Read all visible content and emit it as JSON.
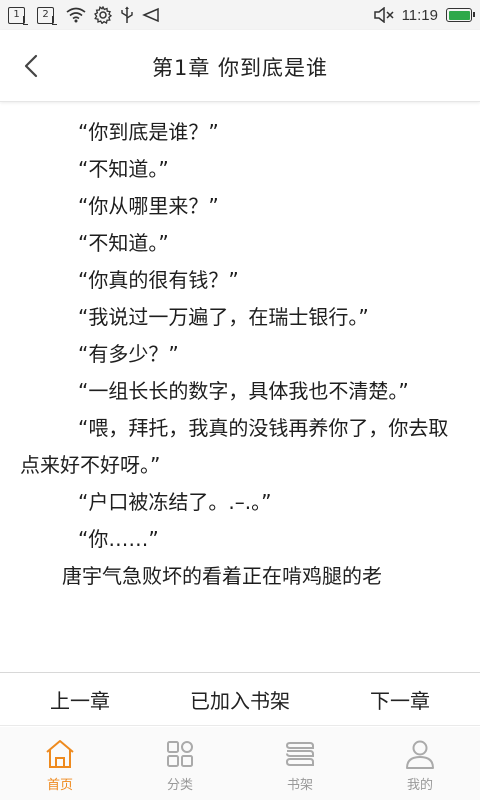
{
  "status_bar": {
    "sim1": "1",
    "sim2": "2",
    "time": "11:19",
    "battery_color": "#2ea84a"
  },
  "header": {
    "title": "第1章  你到底是谁"
  },
  "content": {
    "paragraphs": [
      "“你到底是谁？”",
      "“不知道。”",
      "“你从哪里来？”",
      "“不知道。”",
      "“你真的很有钱？”",
      "“我说过一万遍了，在瑞士银行。”",
      "“有多少？”",
      "“一组长长的数字，具体我也不清楚。”",
      "“喂，拜托，我真的没钱再养你了，你去取点来好不好呀。”",
      "“户口被冻结了。.–.。”",
      "“你……”",
      "唐宇气急败坏的看着正在啃鸡腿的老"
    ]
  },
  "chapter_nav": {
    "prev": "上一章",
    "bookshelf": "已加入书架",
    "next": "下一章"
  },
  "tabbar": {
    "accent_color": "#ee8a1e",
    "tabs": [
      {
        "label": "首页",
        "icon": "home-icon",
        "active": true
      },
      {
        "label": "分类",
        "icon": "category-icon",
        "active": false
      },
      {
        "label": "书架",
        "icon": "bookshelf-icon",
        "active": false
      },
      {
        "label": "我的",
        "icon": "profile-icon",
        "active": false
      }
    ]
  }
}
